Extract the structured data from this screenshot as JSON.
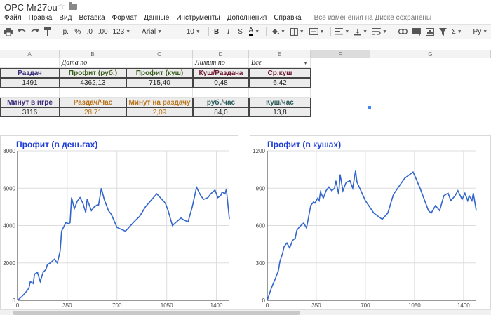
{
  "doc": {
    "title": "ОРС Mr27ou",
    "star_icon": "star-icon",
    "folder_icon": "folder-icon"
  },
  "menu": {
    "items": [
      "Файл",
      "Правка",
      "Вид",
      "Вставка",
      "Формат",
      "Данные",
      "Инструменты",
      "Дополнения",
      "Справка"
    ],
    "save_status": "Все изменения на Диске сохранены"
  },
  "toolbar": {
    "currency": "р.",
    "percent": "%",
    "dec_less": ".0",
    "dec_more": ".00",
    "more_formats": "123",
    "font": "Arial",
    "size": "10",
    "bold": "B",
    "italic": "I",
    "strike": "S",
    "text_color": "A",
    "sigma": "Σ",
    "input_tools": "Ру"
  },
  "columns": [
    "A",
    "B",
    "C",
    "D",
    "E",
    "F",
    "G"
  ],
  "sheet": {
    "row1": {
      "b": "Дата по",
      "d": "Лимит по",
      "e": "Все"
    },
    "row2": {
      "a": "Раздач",
      "b": "Профит (руб.)",
      "c": "Профит (куш)",
      "d": "Куш/Раздача",
      "e": "Ср.куш"
    },
    "row3": {
      "a": "1491",
      "b": "4362,13",
      "c": "715,40",
      "d": "0,48",
      "e": "6,42"
    },
    "row5": {
      "a": "Минут в игре",
      "b": "Раздач/Час",
      "c": "Минут на раздачу",
      "d": "руб./час",
      "e": "Куш/час"
    },
    "row6": {
      "a": "3116",
      "b": "28,71",
      "c": "2,09",
      "d": "84,0",
      "e": "13,8"
    }
  },
  "colors": {
    "header_purple": "#3b2a7a",
    "header_green": "#3a5f1e",
    "header_maroon": "#6e1a2e",
    "header_orange": "#b8741a",
    "header_teal": "#2a5a5a",
    "chart_line": "#3366cc",
    "chart_title": "#1c3bd6"
  },
  "chart_data": [
    {
      "type": "line",
      "title": "Профит (в деньгах)",
      "xlim": [
        0,
        1491
      ],
      "ylim": [
        0,
        8000
      ],
      "xticks": [
        "0",
        "350",
        "700",
        "1050",
        "1400"
      ],
      "yticks": [
        "0",
        "2000",
        "4000",
        "6000",
        "8000"
      ],
      "grid": true,
      "series": [
        {
          "x": [
            0,
            30,
            60,
            80,
            90,
            110,
            120,
            140,
            160,
            180,
            200,
            210,
            230,
            260,
            280,
            290,
            300,
            310,
            330,
            340,
            360,
            370,
            380,
            400,
            420,
            440,
            460,
            480,
            490,
            510,
            520,
            540,
            560,
            570,
            590,
            610,
            630,
            640,
            660,
            700,
            760,
            820,
            860,
            900,
            980,
            1040,
            1060,
            1090,
            1150,
            1170,
            1200,
            1230,
            1260,
            1290,
            1310,
            1340,
            1360,
            1390,
            1410,
            1430,
            1440,
            1460,
            1470,
            1491
          ],
          "values": [
            0,
            200,
            450,
            650,
            1000,
            900,
            1400,
            1500,
            1000,
            1500,
            1650,
            1900,
            2000,
            2200,
            2000,
            2300,
            2650,
            3700,
            4000,
            4150,
            4100,
            4150,
            5500,
            4900,
            5300,
            5500,
            5200,
            4700,
            5400,
            5000,
            4800,
            5000,
            5100,
            5100,
            6000,
            5400,
            5000,
            4800,
            4600,
            3900,
            3700,
            4200,
            4500,
            5000,
            5700,
            5200,
            4800,
            4000,
            4400,
            4300,
            4200,
            5000,
            6050,
            5600,
            5400,
            5500,
            5700,
            5900,
            5500,
            5600,
            5800,
            5700,
            5950,
            4350
          ]
        }
      ]
    },
    {
      "type": "line",
      "title": "Профит (в кушах)",
      "xlim": [
        0,
        1491
      ],
      "ylim": [
        0,
        1200
      ],
      "xticks": [
        "0",
        "350",
        "700",
        "1050",
        "1400"
      ],
      "yticks": [
        "0",
        "300",
        "600",
        "900",
        "1200"
      ],
      "grid": true,
      "series": [
        {
          "x": [
            0,
            30,
            60,
            80,
            90,
            110,
            120,
            140,
            160,
            180,
            200,
            210,
            230,
            260,
            280,
            290,
            300,
            310,
            330,
            340,
            360,
            370,
            380,
            400,
            420,
            440,
            460,
            480,
            490,
            510,
            520,
            540,
            560,
            570,
            590,
            610,
            630,
            640,
            660,
            700,
            760,
            820,
            860,
            900,
            980,
            1040,
            1060,
            1090,
            1150,
            1170,
            1200,
            1230,
            1260,
            1290,
            1310,
            1340,
            1360,
            1390,
            1410,
            1430,
            1440,
            1460,
            1470,
            1491
          ],
          "values": [
            0,
            100,
            180,
            240,
            310,
            380,
            430,
            460,
            420,
            480,
            500,
            560,
            590,
            620,
            580,
            640,
            700,
            760,
            790,
            780,
            820,
            800,
            870,
            820,
            880,
            910,
            880,
            900,
            960,
            850,
            1010,
            880,
            940,
            950,
            960,
            900,
            1040,
            950,
            900,
            800,
            700,
            650,
            700,
            850,
            980,
            1030,
            980,
            900,
            720,
            700,
            760,
            720,
            840,
            860,
            800,
            840,
            880,
            810,
            860,
            800,
            840,
            800,
            860,
            720
          ]
        }
      ]
    }
  ]
}
